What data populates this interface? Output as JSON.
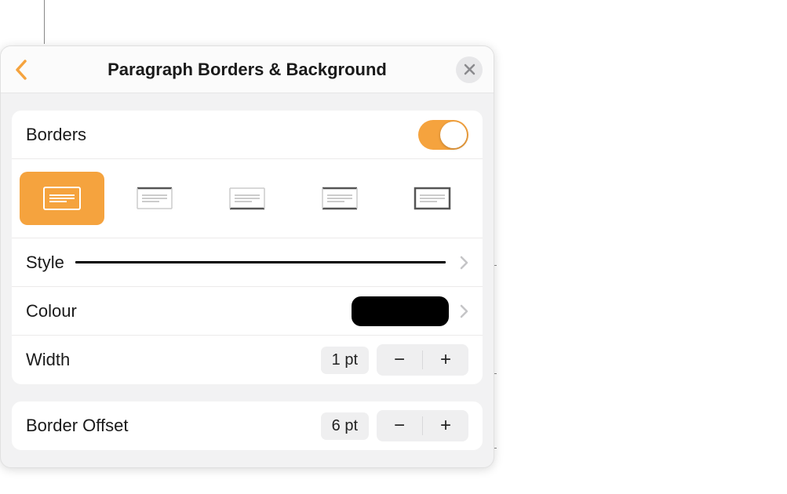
{
  "header": {
    "title": "Paragraph Borders & Background"
  },
  "sections": {
    "borders": {
      "label": "Borders",
      "toggle_on": true
    },
    "style": {
      "label": "Style"
    },
    "colour": {
      "label": "Colour",
      "value_hex": "#000000"
    },
    "width": {
      "label": "Width",
      "value_display": "1 pt",
      "minus": "−",
      "plus": "+"
    },
    "offset": {
      "label": "Border Offset",
      "value_display": "6 pt",
      "minus": "−",
      "plus": "+"
    }
  },
  "border_types": [
    {
      "id": "all",
      "selected": true
    },
    {
      "id": "top",
      "selected": false
    },
    {
      "id": "bottom",
      "selected": false
    },
    {
      "id": "top-bottom",
      "selected": false
    },
    {
      "id": "box",
      "selected": false
    }
  ],
  "colors": {
    "accent": "#f5a33e"
  }
}
